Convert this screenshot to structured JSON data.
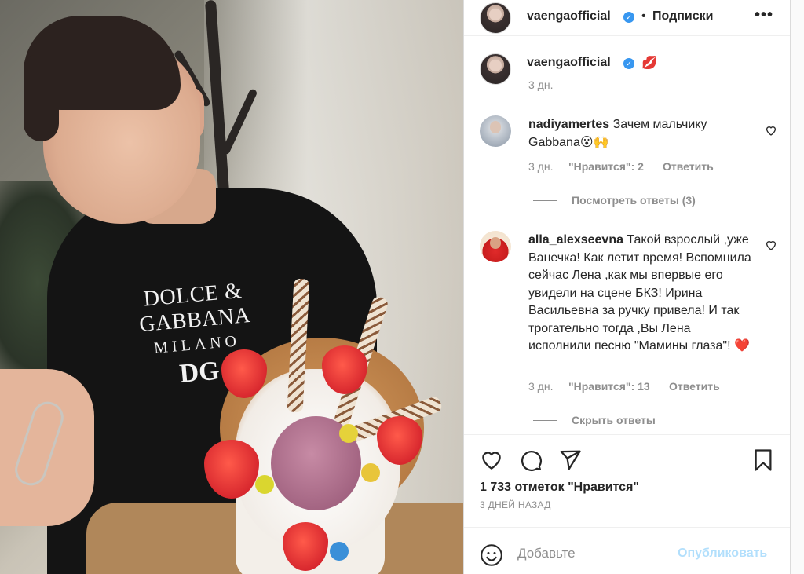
{
  "photo": {
    "shirt_logo_line1": "DOLCE & GABBANA",
    "shirt_logo_line2": "MILANO",
    "shirt_logo_line3": "DG"
  },
  "header": {
    "username": "vaengaofficial",
    "separator": "•",
    "follow_label": "Подписки",
    "more_icon": "more-horizontal-icon"
  },
  "caption": {
    "username": "vaengaofficial",
    "emoji": "💋",
    "time": "3 дн."
  },
  "comments": [
    {
      "username": "nadiyamertes",
      "text": "Зачем мальчику Gabbana😮🙌",
      "time": "3 дн.",
      "likes": "\"Нравится\": 2",
      "reply": "Ответить",
      "replies_toggle": "Посмотреть ответы (3)"
    },
    {
      "username": "alla_alexseevna",
      "text": "Такой взрослый ,уже Ванечка! Как летит время! Вспомнила сейчас Лена ,как мы впервые его увидели на сцене БКЗ! Ирина Васильевна за ручку привела! И так трогательно тогда ,Вы Лена исполнили песню \"Мамины глаза\"! ❤️",
      "time": "3 дн.",
      "likes": "\"Нравится\": 13",
      "reply": "Ответить",
      "replies_toggle": "Скрыть ответы"
    }
  ],
  "actions": {
    "icons": [
      "heart-icon",
      "comment-icon",
      "share-icon",
      "bookmark-icon"
    ],
    "likes_text": "1 733 отметок \"Нравится\"",
    "posted_ago": "3 ДНЕЙ НАЗАД"
  },
  "add_comment": {
    "placeholder": "Добавьте",
    "publish_label": "Опубликовать"
  },
  "colors": {
    "verified": "#3897f0",
    "text": "#262626",
    "secondary": "#8e8e8e",
    "publish_disabled": "#b2dffc"
  }
}
